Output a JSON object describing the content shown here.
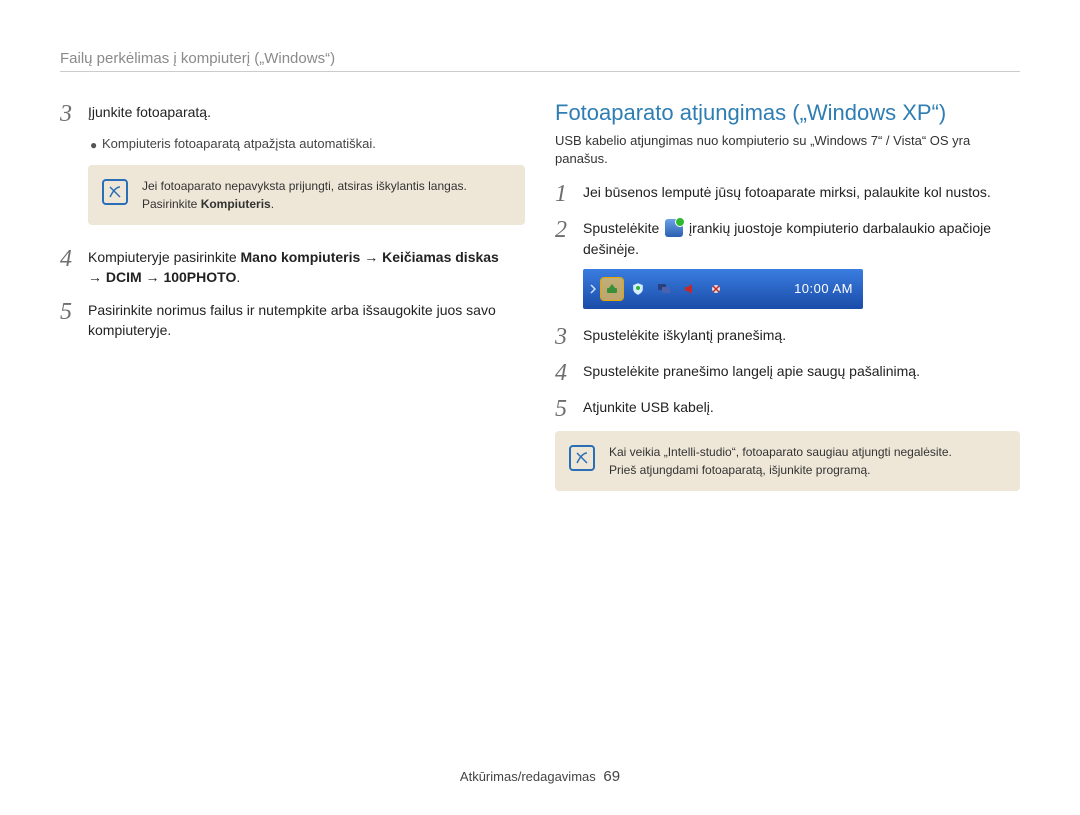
{
  "header": {
    "title": "Failų perkėlimas į kompiuterį („Windows“)"
  },
  "left": {
    "step3": {
      "num": "3",
      "text": "Įjunkite fotoaparatą."
    },
    "bullet": "Kompiuteris fotoaparatą atpažįsta automatiškai.",
    "note": {
      "line1": "Jei fotoaparato nepavyksta prijungti, atsiras iškylantis langas.",
      "line2_prefix": "Pasirinkite ",
      "line2_bold": "Kompiuteris",
      "line2_suffix": "."
    },
    "step4": {
      "num": "4",
      "prefix": "Kompiuteryje pasirinkite ",
      "bold1": "Mano kompiuteris",
      "arrow1": " → ",
      "bold2": "Keičiamas diskas",
      "arrow2": " → ",
      "bold3": "DCIM",
      "arrow3": " → ",
      "bold4": "100PHOTO",
      "suffix": "."
    },
    "step5": {
      "num": "5",
      "text": "Pasirinkite norimus failus ir nutempkite arba išsaugokite juos savo kompiuteryje."
    }
  },
  "right": {
    "title": "Fotoaparato atjungimas („Windows XP“)",
    "intro": "USB kabelio atjungimas nuo kompiuterio su „Windows 7“ / Vista“ OS yra panašus.",
    "step1": {
      "num": "1",
      "text": "Jei būsenos lemputė jūsų fotoaparate mirksi, palaukite kol nustos."
    },
    "step2": {
      "num": "2",
      "prefix": "Spustelėkite ",
      "suffix": " įrankių juostoje kompiuterio darbalaukio apačioje dešinėje."
    },
    "taskbar": {
      "time": "10:00 AM"
    },
    "step3": {
      "num": "3",
      "text": "Spustelėkite iškylantį pranešimą."
    },
    "step4": {
      "num": "4",
      "text": "Spustelėkite pranešimo langelį apie saugų pašalinimą."
    },
    "step5": {
      "num": "5",
      "text": "Atjunkite USB kabelį."
    },
    "note": {
      "line1": "Kai veikia „Intelli-studio“, fotoaparato saugiau atjungti negalėsite.",
      "line2": "Prieš atjungdami fotoaparatą, išjunkite programą."
    }
  },
  "footer": {
    "section": "Atkūrimas/redagavimas",
    "page": "69"
  }
}
